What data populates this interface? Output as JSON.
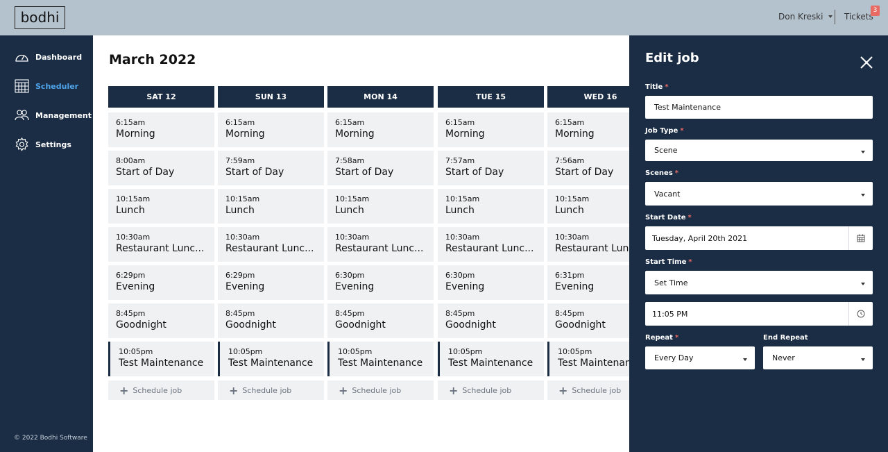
{
  "header": {
    "logo": "bodhi",
    "user_name": "Don Kreski",
    "tickets_label": "Tickets",
    "tickets_count": "3"
  },
  "sidebar": {
    "items": [
      {
        "label": "Dashboard",
        "icon": "dashboard-gauge-icon",
        "active": false
      },
      {
        "label": "Scheduler",
        "icon": "calendar-grid-icon",
        "active": true
      },
      {
        "label": "Management",
        "icon": "people-icon",
        "active": false
      },
      {
        "label": "Settings",
        "icon": "gear-icon",
        "active": false
      }
    ],
    "copyright": "© 2022 Bodhi Software"
  },
  "main": {
    "title": "March 2022",
    "schedule_label": "Schedule job",
    "days": [
      {
        "label": "SAT 12",
        "jobs": [
          {
            "time": "6:15am",
            "name": "Morning"
          },
          {
            "time": "8:00am",
            "name": "Start of Day"
          },
          {
            "time": "10:15am",
            "name": "Lunch"
          },
          {
            "time": "10:30am",
            "name": "Restaurant Lunc..."
          },
          {
            "time": "6:29pm",
            "name": "Evening"
          },
          {
            "time": "8:45pm",
            "name": "Goodnight"
          },
          {
            "time": "10:05pm",
            "name": "Test Maintenance"
          }
        ]
      },
      {
        "label": "SUN 13",
        "jobs": [
          {
            "time": "6:15am",
            "name": "Morning"
          },
          {
            "time": "7:59am",
            "name": "Start of Day"
          },
          {
            "time": "10:15am",
            "name": "Lunch"
          },
          {
            "time": "10:30am",
            "name": "Restaurant Lunc..."
          },
          {
            "time": "6:29pm",
            "name": "Evening"
          },
          {
            "time": "8:45pm",
            "name": "Goodnight"
          },
          {
            "time": "10:05pm",
            "name": "Test Maintenance"
          }
        ]
      },
      {
        "label": "MON 14",
        "jobs": [
          {
            "time": "6:15am",
            "name": "Morning"
          },
          {
            "time": "7:58am",
            "name": "Start of Day"
          },
          {
            "time": "10:15am",
            "name": "Lunch"
          },
          {
            "time": "10:30am",
            "name": "Restaurant Lunc..."
          },
          {
            "time": "6:30pm",
            "name": "Evening"
          },
          {
            "time": "8:45pm",
            "name": "Goodnight"
          },
          {
            "time": "10:05pm",
            "name": "Test Maintenance"
          }
        ]
      },
      {
        "label": "TUE 15",
        "jobs": [
          {
            "time": "6:15am",
            "name": "Morning"
          },
          {
            "time": "7:57am",
            "name": "Start of Day"
          },
          {
            "time": "10:15am",
            "name": "Lunch"
          },
          {
            "time": "10:30am",
            "name": "Restaurant Lunc..."
          },
          {
            "time": "6:30pm",
            "name": "Evening"
          },
          {
            "time": "8:45pm",
            "name": "Goodnight"
          },
          {
            "time": "10:05pm",
            "name": "Test Maintenance"
          }
        ]
      },
      {
        "label": "WED 16",
        "jobs": [
          {
            "time": "6:15am",
            "name": "Morning"
          },
          {
            "time": "7:56am",
            "name": "Start of Day"
          },
          {
            "time": "10:15am",
            "name": "Lunch"
          },
          {
            "time": "10:30am",
            "name": "Restaurant Lunc"
          },
          {
            "time": "6:31pm",
            "name": "Evening"
          },
          {
            "time": "8:45pm",
            "name": "Goodnight"
          },
          {
            "time": "10:05pm",
            "name": "Test Maintenan"
          }
        ]
      }
    ]
  },
  "edit_panel": {
    "title": "Edit job",
    "title_label": "Title",
    "title_value": "Test Maintenance",
    "job_type_label": "Job Type",
    "job_type_value": "Scene",
    "scenes_label": "Scenes",
    "scenes_value": "Vacant",
    "start_date_label": "Start Date",
    "start_date_value": "Tuesday, April 20th 2021",
    "start_time_label": "Start Time",
    "start_time_value": "Set Time",
    "time_value": "11:05 PM",
    "repeat_label": "Repeat",
    "repeat_value": "Every Day",
    "end_repeat_label": "End Repeat",
    "end_repeat_value": "Never",
    "required_mark": "*"
  },
  "colors": {
    "topbar": "#b4c2ce",
    "navy": "#1b2d45",
    "active_nav": "#4fa3e8",
    "card": "#f0f1f2",
    "required": "#e86a63"
  }
}
